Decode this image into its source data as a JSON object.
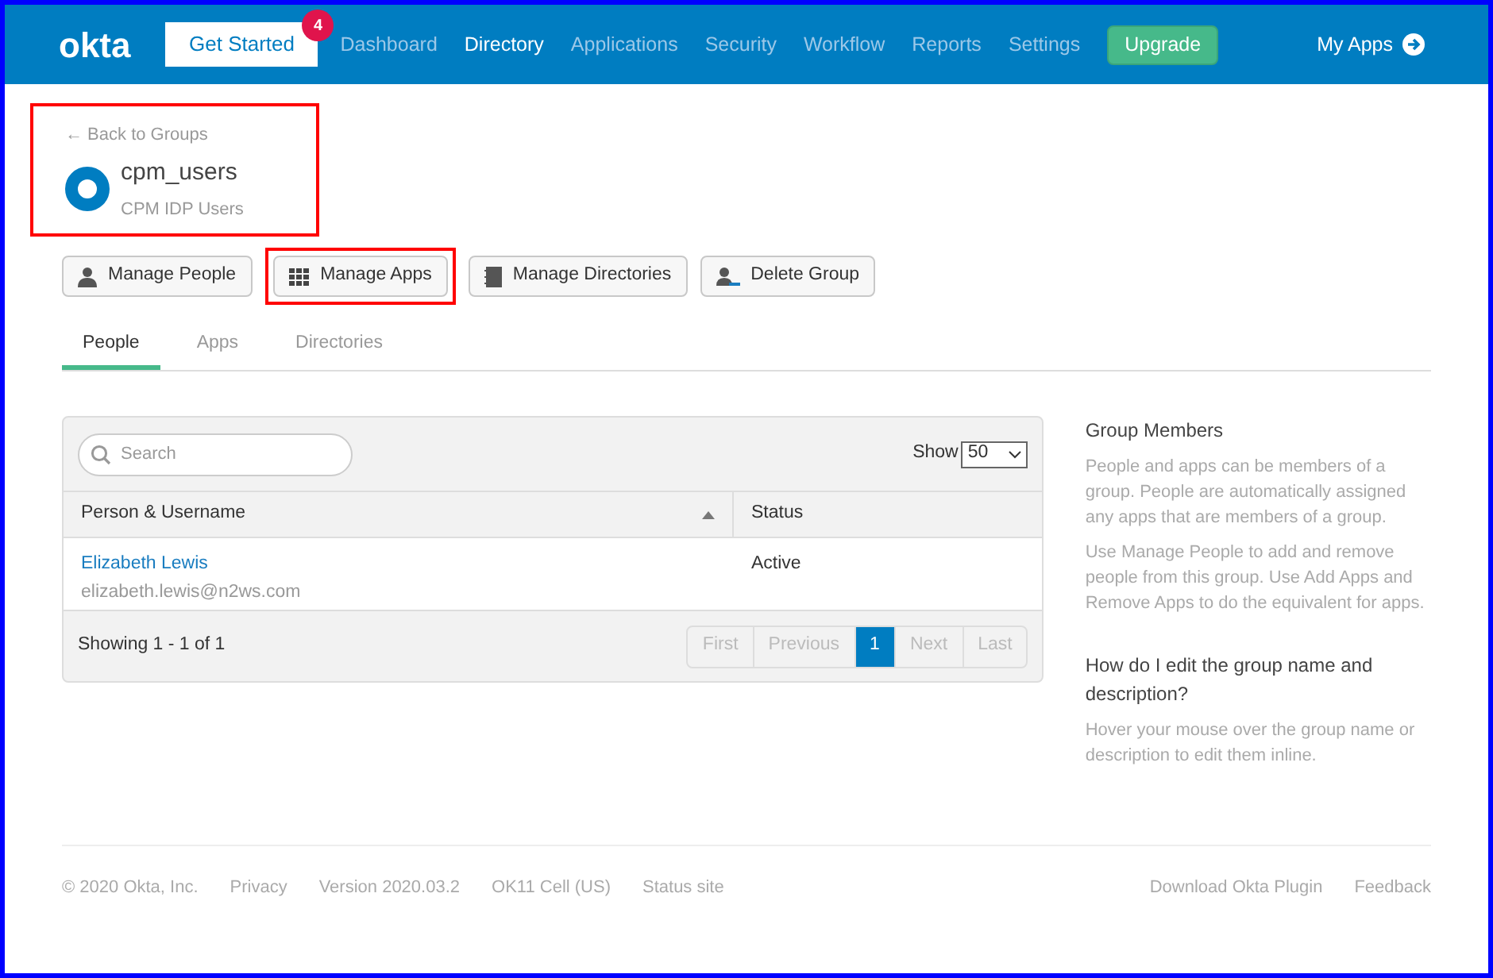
{
  "nav": {
    "logo": "okta",
    "get_started": {
      "label": "Get Started",
      "badge": "4"
    },
    "items": [
      {
        "label": "Dashboard",
        "selected": false
      },
      {
        "label": "Directory",
        "selected": true
      },
      {
        "label": "Applications",
        "selected": false
      },
      {
        "label": "Security",
        "selected": false
      },
      {
        "label": "Workflow",
        "selected": false
      },
      {
        "label": "Reports",
        "selected": false
      },
      {
        "label": "Settings",
        "selected": false
      }
    ],
    "upgrade": "Upgrade",
    "my_apps": "My Apps"
  },
  "group": {
    "back": "← Back to Groups",
    "name": "cpm_users",
    "description": "CPM IDP Users",
    "highlighted": true
  },
  "actions": [
    {
      "kind": "person",
      "label": "Manage People",
      "highlighted": false
    },
    {
      "kind": "grid",
      "label": "Manage Apps",
      "highlighted": true
    },
    {
      "kind": "book",
      "label": "Manage Directories",
      "highlighted": false
    },
    {
      "kind": "remove",
      "label": "Delete Group",
      "highlighted": false
    }
  ],
  "tabs": [
    {
      "label": "People",
      "selected": true
    },
    {
      "label": "Apps",
      "selected": false
    },
    {
      "label": "Directories",
      "selected": false
    }
  ],
  "table": {
    "search": {
      "placeholder": "Search"
    },
    "show_label": "Show",
    "show_value": "50",
    "columns": [
      "Person & Username",
      "Status"
    ],
    "rows": [
      {
        "name": "Elizabeth Lewis",
        "username": "elizabeth.lewis@n2ws.com",
        "status": "Active"
      }
    ],
    "showing": "Showing 1 - 1 of 1",
    "pages": [
      {
        "label": "First",
        "selected": false
      },
      {
        "label": "Previous",
        "selected": false
      },
      {
        "label": "1",
        "selected": true
      },
      {
        "label": "Next",
        "selected": false
      },
      {
        "label": "Last",
        "selected": false
      }
    ]
  },
  "help": [
    {
      "title": "Group Members",
      "paragraphs": [
        "People and apps can be members of a group. People are automatically assigned any apps that are members of a group.",
        "Use Manage People to add and remove people from this group. Use Add Apps and Remove Apps to do the equivalent for apps."
      ]
    },
    {
      "title": "How do I edit the group name and description?",
      "paragraphs": [
        "Hover your mouse over the group name or description to edit them inline."
      ]
    }
  ],
  "footer": {
    "left": [
      "© 2020 Okta, Inc.",
      "Privacy",
      "Version 2020.03.2",
      "OK11 Cell (US)",
      "Status site"
    ],
    "right": [
      "Download Okta Plugin",
      "Feedback"
    ]
  }
}
